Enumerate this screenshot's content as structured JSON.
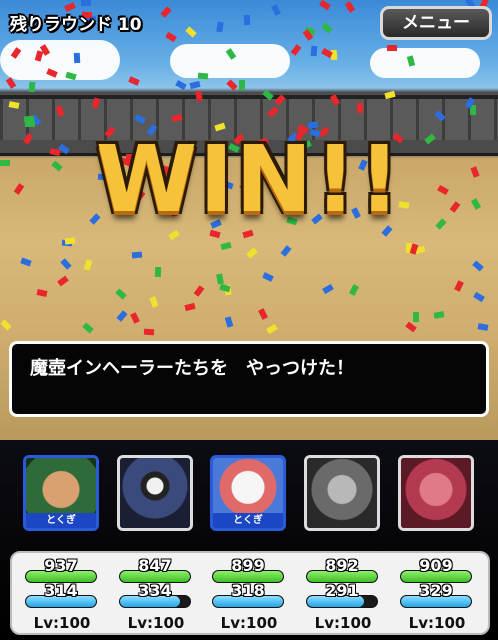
{
  "header": {
    "round_label": "残りラウンド 10",
    "menu_label": "メニュー"
  },
  "result": {
    "text": "WIN!!"
  },
  "message": {
    "text": "魔壺インヘーラーたちを　やっつけた！"
  },
  "party": [
    {
      "name": "member-1",
      "tag": "とくぎ",
      "hp": "937",
      "mp": "314",
      "hp_fraction": 1.0,
      "mp_fraction": 1.0,
      "level": "Lv:100",
      "color": "#2f6b3a"
    },
    {
      "name": "member-2",
      "tag": "",
      "hp": "847",
      "mp": "334",
      "hp_fraction": 1.0,
      "mp_fraction": 0.85,
      "level": "Lv:100",
      "color": "#3a4a7a"
    },
    {
      "name": "member-3",
      "tag": "とくぎ",
      "hp": "899",
      "mp": "318",
      "hp_fraction": 1.0,
      "mp_fraction": 1.0,
      "level": "Lv:100",
      "color": "#4a7ad8"
    },
    {
      "name": "member-4",
      "tag": "",
      "hp": "892",
      "mp": "291",
      "hp_fraction": 1.0,
      "mp_fraction": 0.82,
      "level": "Lv:100",
      "color": "#6a6a6a"
    },
    {
      "name": "member-5",
      "tag": "",
      "hp": "909",
      "mp": "329",
      "hp_fraction": 1.0,
      "mp_fraction": 1.0,
      "level": "Lv:100",
      "color": "#8a2a3a"
    }
  ]
}
